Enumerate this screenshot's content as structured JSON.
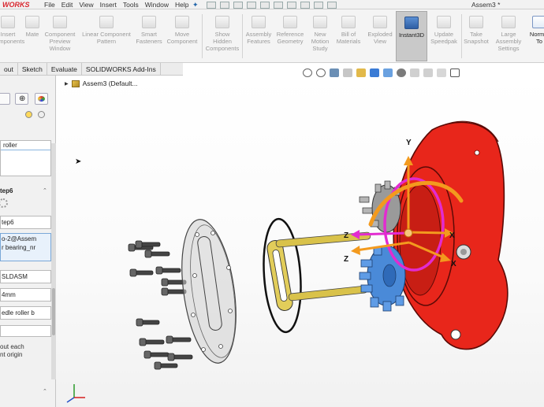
{
  "app": {
    "logo": "WORKS",
    "document_title": "Assem3 *"
  },
  "menu": [
    "File",
    "Edit",
    "View",
    "Insert",
    "Tools",
    "Window",
    "Help"
  ],
  "ribbon": [
    {
      "label": "Insert\nComponents"
    },
    {
      "label": "Mate"
    },
    {
      "label": "Component\nPreview\nWindow"
    },
    {
      "label": "Linear Component\nPattern"
    },
    {
      "label": "Smart\nFasteners"
    },
    {
      "label": "Move\nComponent"
    },
    {
      "label": "Show\nHidden\nComponents"
    },
    {
      "label": "Assembly\nFeatures"
    },
    {
      "label": "Reference\nGeometry"
    },
    {
      "label": "New\nMotion\nStudy"
    },
    {
      "label": "Bill of\nMaterials"
    },
    {
      "label": "Exploded\nView"
    },
    {
      "label": "Instant3D"
    },
    {
      "label": "Update\nSpeedpak"
    },
    {
      "label": "Take\nSnapshot"
    },
    {
      "label": "Large\nAssembly\nSettings"
    },
    {
      "label": "Normal\nTo"
    }
  ],
  "tabs": [
    "out",
    "Sketch",
    "Evaluate",
    "SOLIDWORKS Add-Ins"
  ],
  "tree": {
    "root_label": "Assem3  (Default..."
  },
  "property_manager": {
    "list_item": "roller",
    "section_title": "tep6",
    "step_name": "tep6",
    "components": [
      "o-2@Assem",
      "r bearing_nr"
    ],
    "file_field": "SLDASM",
    "distance_field": "4mm",
    "component_field": "edle roller b",
    "option_text_1": "out each",
    "option_text_2": "nt origin"
  },
  "triad": {
    "x": "X",
    "y": "Y",
    "z": "Z"
  },
  "colors": {
    "housing": "#e8261b",
    "gear": "#4a8ad8",
    "pins": "#d9c24a",
    "triad_orange": "#f39a1e",
    "triad_magenta": "#e22bd0",
    "active_tool": "#c9c9c9"
  },
  "icons": [
    "search-icon",
    "zoom-area-icon",
    "previous-view-icon",
    "section-view-icon",
    "view-orientation-icon",
    "display-style-icon",
    "hide-show-icon",
    "edit-appearance-icon",
    "apply-scene-icon",
    "view-settings-icon",
    "display-icon",
    "pin-icon"
  ]
}
